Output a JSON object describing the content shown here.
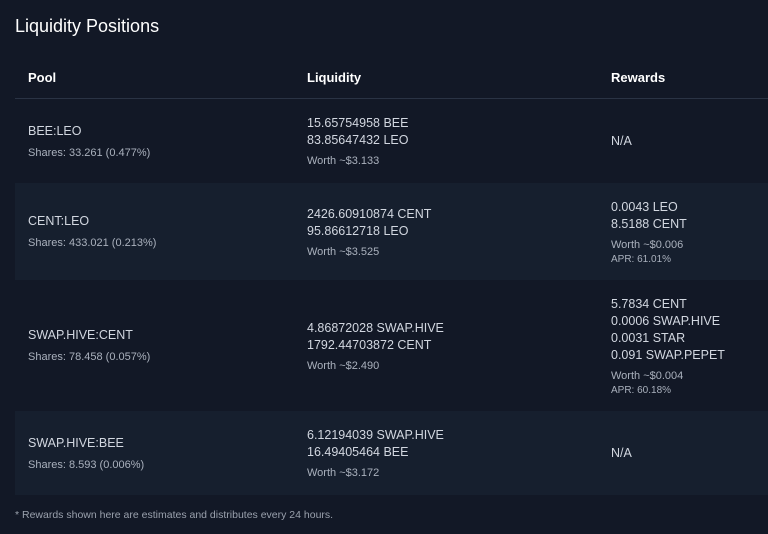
{
  "page": {
    "title": "Liquidity Positions"
  },
  "table": {
    "headers": {
      "pool": "Pool",
      "liquidity": "Liquidity",
      "rewards": "Rewards"
    },
    "rows": [
      {
        "pool": "BEE:LEO",
        "shares": "Shares: 33.261 (0.477%)",
        "liquidity": [
          "15.65754958 BEE",
          "83.85647432 LEO"
        ],
        "worth": "Worth ~$3.133",
        "rewards": [],
        "rewards_na": "N/A"
      },
      {
        "pool": "CENT:LEO",
        "shares": "Shares: 433.021 (0.213%)",
        "liquidity": [
          "2426.60910874 CENT",
          "95.86612718 LEO"
        ],
        "worth": "Worth ~$3.525",
        "rewards": [
          "0.0043 LEO",
          "8.5188 CENT"
        ],
        "rewards_worth": "Worth ~$0.006",
        "rewards_apr": "APR: 61.01%"
      },
      {
        "pool": "SWAP.HIVE:CENT",
        "shares": "Shares: 78.458 (0.057%)",
        "liquidity": [
          "4.86872028 SWAP.HIVE",
          "1792.44703872 CENT"
        ],
        "worth": "Worth ~$2.490",
        "rewards": [
          "5.7834 CENT",
          "0.0006 SWAP.HIVE",
          "0.0031 STAR",
          "0.091 SWAP.PEPET"
        ],
        "rewards_worth": "Worth ~$0.004",
        "rewards_apr": "APR: 60.18%"
      },
      {
        "pool": "SWAP.HIVE:BEE",
        "shares": "Shares: 8.593 (0.006%)",
        "liquidity": [
          "6.12194039 SWAP.HIVE",
          "16.49405464 BEE"
        ],
        "worth": "Worth ~$3.172",
        "rewards": [],
        "rewards_na": "N/A"
      }
    ]
  },
  "footnote": "* Rewards shown here are estimates and distributes every 24 hours."
}
